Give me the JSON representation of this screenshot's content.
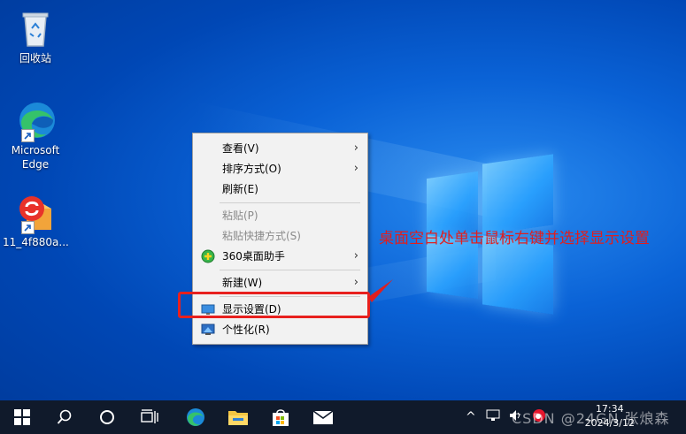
{
  "desktop": {
    "icons": [
      {
        "label": "回收站",
        "icon": "recycle-bin-icon"
      },
      {
        "label": "Microsoft Edge",
        "icon": "edge-icon"
      },
      {
        "label": "11_4f880a...",
        "icon": "installer-icon"
      }
    ]
  },
  "context_menu": {
    "items": [
      {
        "label": "查看(V)",
        "submenu": true,
        "disabled": false
      },
      {
        "label": "排序方式(O)",
        "submenu": true,
        "disabled": false
      },
      {
        "label": "刷新(E)",
        "submenu": false,
        "disabled": false
      },
      {
        "label": "粘贴(P)",
        "submenu": false,
        "disabled": true
      },
      {
        "label": "粘贴快捷方式(S)",
        "submenu": false,
        "disabled": true
      },
      {
        "label": "360桌面助手",
        "submenu": true,
        "disabled": false,
        "icon": "360-icon"
      },
      {
        "label": "新建(W)",
        "submenu": true,
        "disabled": false
      },
      {
        "label": "显示设置(D)",
        "submenu": false,
        "disabled": false,
        "icon": "display-icon"
      },
      {
        "label": "个性化(R)",
        "submenu": false,
        "disabled": false,
        "icon": "personalize-icon"
      }
    ],
    "arrow_glyph": "›"
  },
  "annotation": {
    "text": "桌面空白处单击鼠标右键并选择显示设置",
    "color": "#e01e1e"
  },
  "taskbar": {
    "clock_time": "17:34",
    "clock_date": "2024/3/12",
    "tray_up_arrow": "^",
    "watermark": "CSDN @24GN 张烺森"
  },
  "colors": {
    "taskbar": "#101a2b",
    "desktop_blue": "#0a62d6",
    "menu_bg": "#f2f2f2",
    "highlight": "#e8201e"
  }
}
